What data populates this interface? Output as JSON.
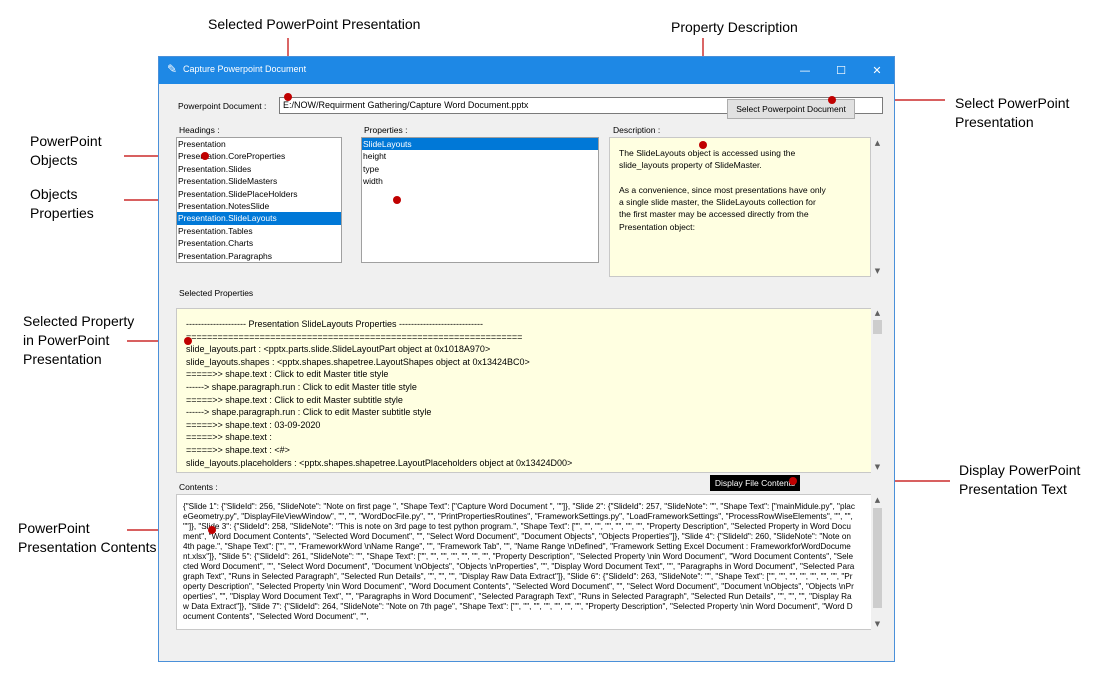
{
  "annotations": {
    "selected_presentation": "Selected PowerPoint Presentation",
    "property_description": "Property Description",
    "select_presentation": [
      "Select PowerPoint",
      "Presentation"
    ],
    "powerpoint_objects": [
      "PowerPoint",
      "Objects"
    ],
    "objects_properties": [
      "Objects",
      "Properties"
    ],
    "selected_property": [
      "Selected Property",
      "in PowerPoint",
      "Presentation"
    ],
    "display_text": [
      "Display PowerPoint",
      "Presentation Text"
    ],
    "presentation_contents": [
      "PowerPoint",
      "Presentation Contents"
    ]
  },
  "window": {
    "title": "Capture Powerpoint Document",
    "minimize": "—",
    "maximize": "☐",
    "close": "✕"
  },
  "document": {
    "label": "Powerpoint Document :",
    "value": "E:/NOW/Requirment Gathering/Capture Word Document.pptx",
    "select_button": "Select Powerpoint Document"
  },
  "headings": {
    "label": "Headings :",
    "items": [
      "Presentation",
      "Presentation.CoreProperties",
      "Presentation.Slides",
      "Presentation.SlideMasters",
      "Presentation.SlidePlaceHolders",
      "Presentation.NotesSlide",
      "Presentation.SlideLayouts",
      "Presentation.Tables",
      "Presentation.Charts",
      "Presentation.Paragraphs"
    ],
    "selected_index": 6
  },
  "properties": {
    "label": "Properties :",
    "items": [
      "SlideLayouts",
      "height",
      "type",
      "width"
    ],
    "selected_index": 0
  },
  "description": {
    "label": "Description :",
    "lines": [
      "The SlideLayouts object is accessed using the",
      "slide_layouts property of SlideMaster.",
      "",
      "As a convenience, since most presentations have only",
      "a single slide master, the SlideLayouts collection for",
      "the first master may be accessed directly from the",
      "Presentation object:"
    ]
  },
  "selected_properties": {
    "label": "Selected Properties",
    "lines": [
      "-------------------- Presentation SlideLayouts Properties ----------------------------",
      "================================================================",
      "slide_layouts.part :  <pptx.parts.slide.SlideLayoutPart object at 0x1018A970>",
      "slide_layouts.shapes :  <pptx.shapes.shapetree.LayoutShapes object at 0x13424BC0>",
      "=====>> shape.text :  Click to edit Master title style",
      "------> shape.paragraph.run :  Click to edit Master title style",
      "=====>> shape.text :  Click to edit Master subtitle style",
      "------> shape.paragraph.run :  Click to edit Master subtitle style",
      "=====>> shape.text :  03-09-2020",
      "=====>> shape.text :",
      "=====>> shape.text :  <#>",
      "slide_layouts.placeholders :  <pptx.shapes.shapetree.LayoutPlaceholders object at 0x13424D00>"
    ]
  },
  "display_button": "Display File Contents",
  "contents": {
    "label": "Contents :",
    "text": "{\"Slide 1\": {\"SlideId\": 256, \"SlideNote\": \"Note on first page  \", \"Shape Text\": [\"Capture Word Document \", \"\"]}, \"Slide 2\": {\"SlideId\": 257, \"SlideNote\": \"\", \"Shape Text\": [\"mainMidule.py\", \"placeGeometry.py\", \"DisplayFileViewWindow\", \"\", \"\", \"WordDocFile.py\", \"\", \"PrintPropertiesRoutines\", \"FrameworkSettings.py\", \"LoadFrameworkSettings\", \"ProcessRowWiseElements\", \"\", \"\", \"\"]}, \"Slide 3\": {\"SlideId\": 258, \"SlideNote\": \"This is note on 3rd page to test python program.\", \"Shape Text\": [\"\", \"\", \"\", \"\", \"\", \"\", \"\", \"Property Description\", \"Selected Property in Word Document\", \"Word Document Contents\", \"Selected Word Document\", \"\", \"Select Word Document\", \"Document Objects\", \"Objects Properties\"]}, \"Slide 4\": {\"SlideId\": 260, \"SlideNote\": \"Note on 4th page.\", \"Shape Text\": [\"\", \"\", \"FrameworkWord \\nName Range\", \"\", \"Framework Tab\", \"\", \"Name Range \\nDefined\", \"Framework Setting Excel Document :  FrameworkforWordDocument.xlsx\"]}, \"Slide 5\": {\"SlideId\": 261, \"SlideNote\": \"\", \"Shape Text\": [\"\", \"\", \"\", \"\", \"\", \"\", \"\", \"Property Description\", \"Selected Property \\nin Word Document\", \"Word Document Contents\", \"Selected Word Document\", \"\", \"Select Word Document\", \"Document \\nObjects\", \"Objects \\nProperties\", \"\", \"Display Word Document Text\", \"\", \"Paragraphs in Word Document\", \"Selected Paragraph Text\", \"Runs in Selected Paragraph\", \"Selected Run Details\", \"\", \"\", \"\", \"Display Raw Data Extract\"]}, \"Slide 6\": {\"SlideId\": 263, \"SlideNote\": \"\", \"Shape Text\": [\"\", \"\", \"\", \"\", \"\", \"\", \"\", \"Property Description\", \"Selected Property \\nin Word Document\", \"Word Document Contents\", \"Selected Word Document\", \"\", \"Select Word Document\", \"Document \\nObjects\", \"Objects \\nProperties\", \"\", \"Display Word Document Text\", \"\", \"Paragraphs in Word Document\", \"Selected Paragraph Text\", \"Runs in Selected Paragraph\", \"Selected Run Details\", \"\", \"\", \"\", \"Display Raw Data Extract\"]}, \"Slide 7\": {\"SlideId\": 264, \"SlideNote\": \"Note on 7th page\", \"Shape Text\": [\"\", \"\", \"\", \"\", \"\", \"\", \"\", \"Property Description\", \"Selected Property \\nin Word Document\", \"Word Document Contents\", \"Selected Word Document\", \"\","
  },
  "colors": {
    "titlebar": "#1e88e5",
    "selection": "#0078d7",
    "annotation_line": "#c00000",
    "info_background": "#ffffe1"
  }
}
